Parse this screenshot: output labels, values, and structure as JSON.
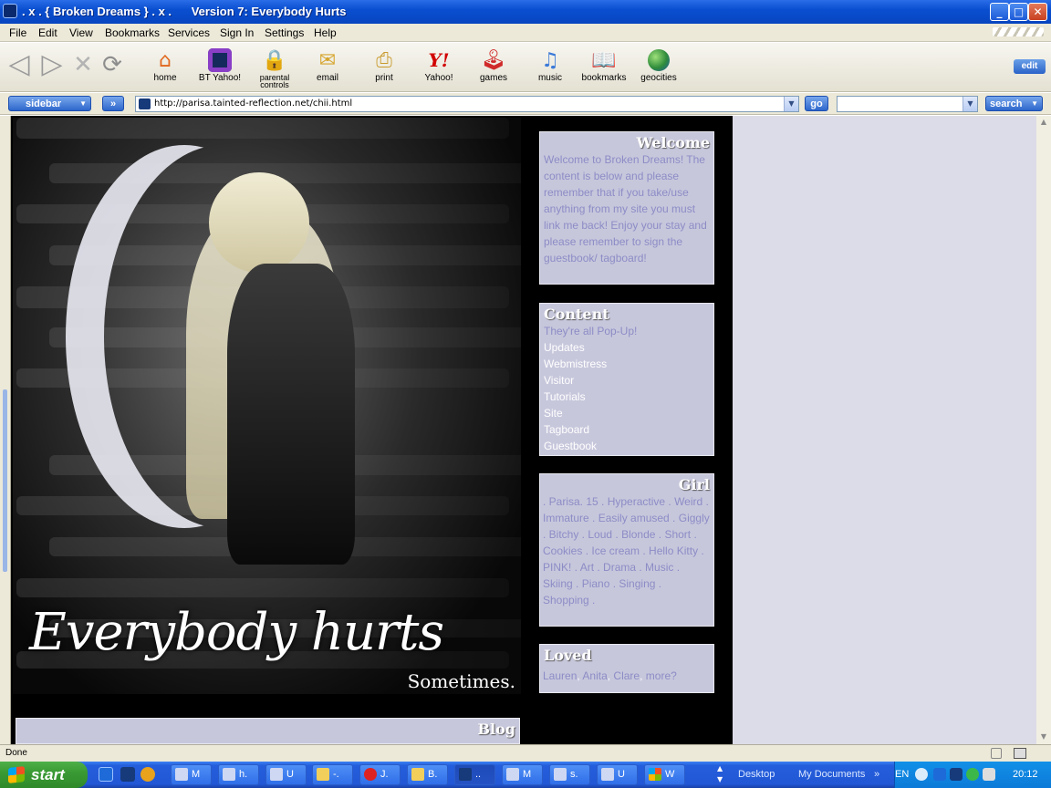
{
  "window": {
    "title": ". x . { Broken Dreams } . x .      Version 7: Everybody Hurts",
    "minimize": "_",
    "maximize": "□",
    "close": "✕"
  },
  "menu": [
    "File",
    "Edit",
    "View",
    "Bookmarks",
    "Services",
    "Sign In",
    "Settings",
    "Help"
  ],
  "toolbar": {
    "buttons": [
      {
        "label": "home",
        "icon": "home-icon"
      },
      {
        "label": "BT Yahoo!",
        "icon": "bt-yahoo-icon"
      },
      {
        "label": "parental controls",
        "icon": "lock-icon"
      },
      {
        "label": "email",
        "icon": "email-icon"
      },
      {
        "label": "print",
        "icon": "printer-icon"
      },
      {
        "label": "Yahoo!",
        "icon": "yahoo-icon"
      },
      {
        "label": "games",
        "icon": "joystick-icon"
      },
      {
        "label": "music",
        "icon": "music-note-icon"
      },
      {
        "label": "bookmarks",
        "icon": "book-icon"
      },
      {
        "label": "geocities",
        "icon": "globe-icon"
      }
    ],
    "edit_label": "edit"
  },
  "addressbar": {
    "sidebar_label": "sidebar",
    "expand_label": "»",
    "url": "http://parisa.tainted-reflection.net/chii.html",
    "go_label": "go",
    "search_label": "search"
  },
  "banner": {
    "title": "Everybody hurts",
    "subtitle": "Sometimes."
  },
  "boxes": {
    "welcome": {
      "title": "Welcome",
      "text": "Welcome to Broken Dreams! The content is below and please remember that if you take/use anything from my site you must link me back! Enjoy your stay and please remember to sign the guestbook/ tagboard!"
    },
    "content": {
      "title": "Content",
      "note": "They're all Pop-Up!",
      "links": [
        "Updates",
        "Webmistress",
        "Visitor",
        "Tutorials",
        "Site",
        "Tagboard",
        "Guestbook"
      ]
    },
    "girl": {
      "title": "Girl",
      "tags": [
        ". Parisa. 15 .",
        "Hyperactive .",
        "Weird .",
        "Immature .",
        "Easily amused .",
        "Giggly .",
        "Bitchy .",
        "Loud .",
        "Blonde .",
        "Short .",
        "Cookies .",
        "Ice cream .",
        "Hello Kitty .",
        "PINK! .",
        "Art .",
        "Drama .",
        "Music .",
        "Skiing .",
        "Piano .",
        "Singing .",
        "Shopping ."
      ]
    },
    "loved": {
      "title": "Loved",
      "names": [
        "Lauren",
        "Anita",
        "Clare",
        "more?"
      ]
    },
    "blog": {
      "title": "Blog"
    }
  },
  "status": "Done",
  "taskbar": {
    "start_label": "start",
    "items": [
      {
        "label": "M"
      },
      {
        "label": "h."
      },
      {
        "label": "U"
      },
      {
        "label": "-."
      },
      {
        "label": "J."
      },
      {
        "label": "B."
      },
      {
        "label": ".."
      },
      {
        "label": "M"
      },
      {
        "label": "s."
      },
      {
        "label": "U"
      },
      {
        "label": "W"
      }
    ],
    "desktop_label": "Desktop",
    "documents_label": "My Documents",
    "lang": "EN",
    "clock": "20:12"
  }
}
